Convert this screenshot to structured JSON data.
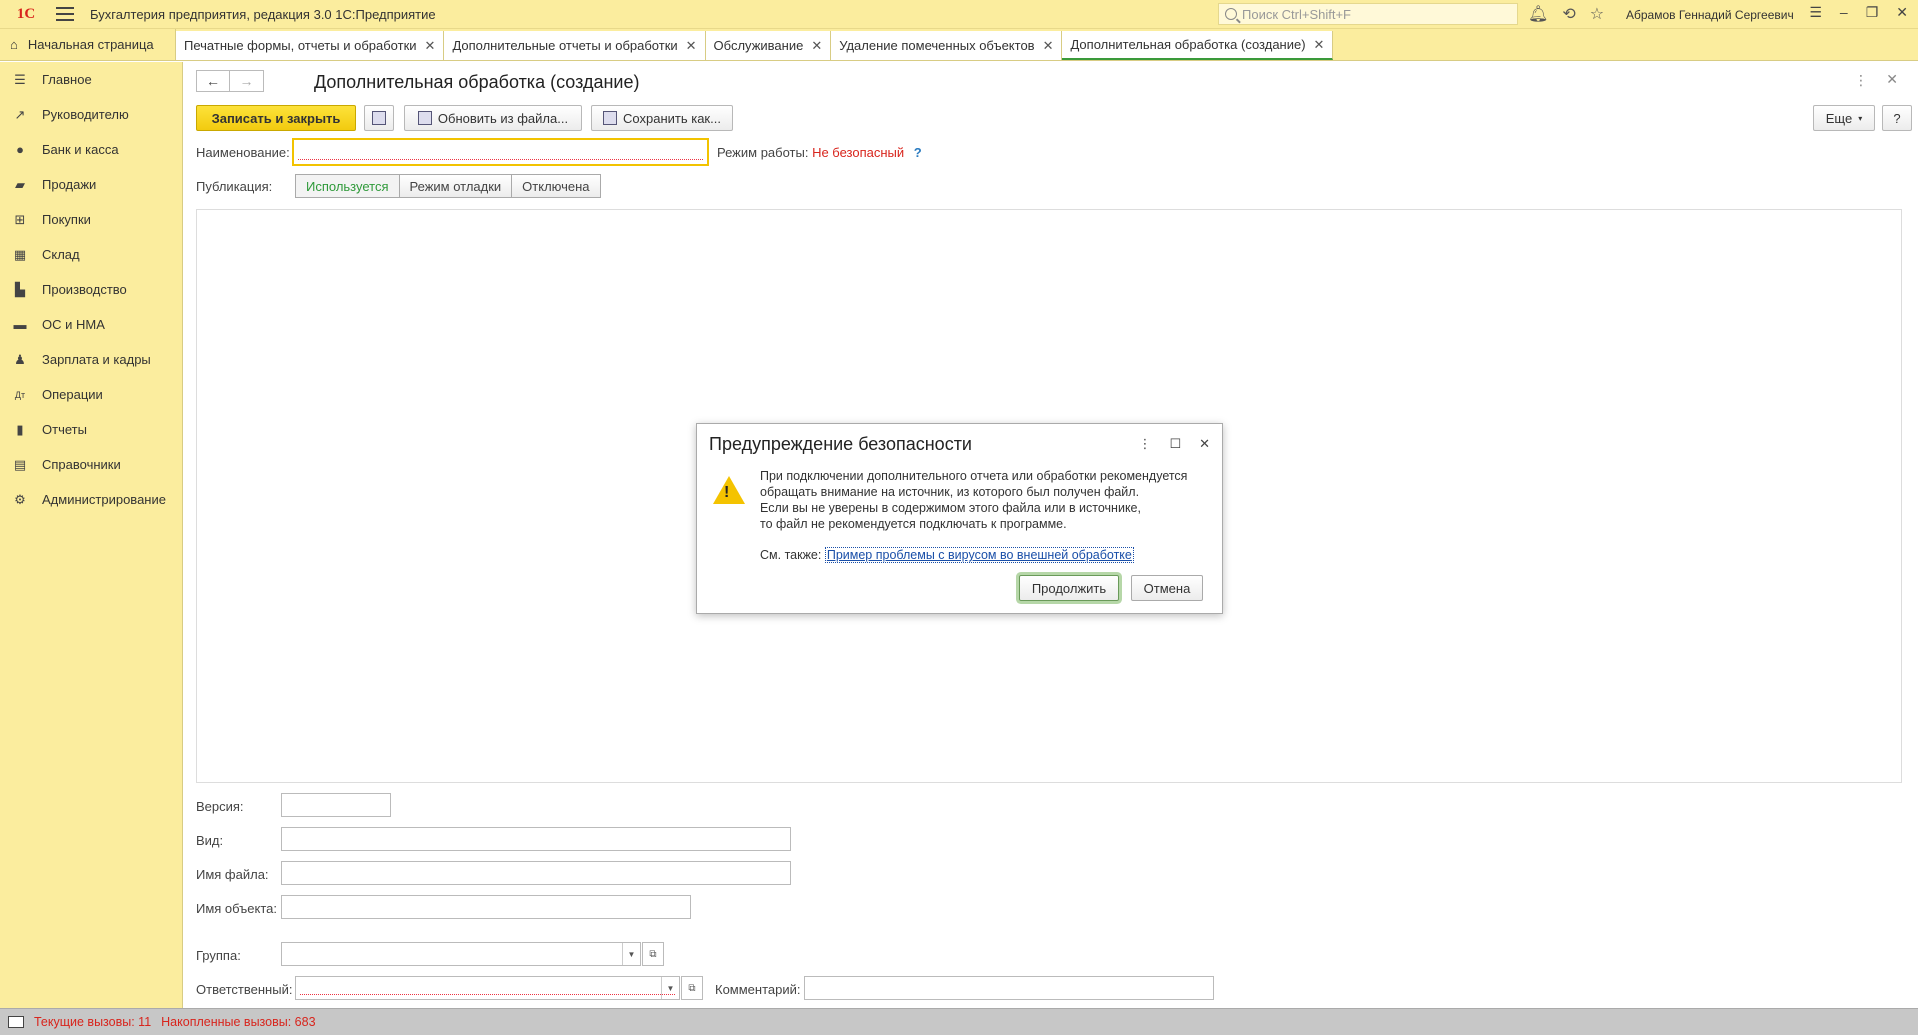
{
  "titlebar": {
    "logo": "1С",
    "app_title": "Бухгалтерия предприятия, редакция 3.0 1С:Предприятие",
    "search_placeholder": "Поиск Ctrl+Shift+F",
    "user_name": "Абрамов Геннадий Сергеевич"
  },
  "tabs": {
    "home": "Начальная страница",
    "items": [
      {
        "label": "Печатные формы, отчеты и обработки"
      },
      {
        "label": "Дополнительные отчеты и обработки"
      },
      {
        "label": "Обслуживание"
      },
      {
        "label": "Удаление помеченных объектов"
      },
      {
        "label": "Дополнительная обработка (создание)"
      }
    ]
  },
  "sidebar": {
    "items": [
      {
        "label": "Главное",
        "icon": "list-icon"
      },
      {
        "label": "Руководителю",
        "icon": "trend-icon"
      },
      {
        "label": "Банк и касса",
        "icon": "coin-icon"
      },
      {
        "label": "Продажи",
        "icon": "bag-icon"
      },
      {
        "label": "Покупки",
        "icon": "cart-icon"
      },
      {
        "label": "Склад",
        "icon": "grid-icon"
      },
      {
        "label": "Производство",
        "icon": "factory-icon"
      },
      {
        "label": "ОС и НМА",
        "icon": "truck-icon"
      },
      {
        "label": "Зарплата и кадры",
        "icon": "person-icon"
      },
      {
        "label": "Операции",
        "icon": "dt-kt-icon"
      },
      {
        "label": "Отчеты",
        "icon": "bar-chart-icon"
      },
      {
        "label": "Справочники",
        "icon": "book-icon"
      },
      {
        "label": "Администрирование",
        "icon": "gear-icon"
      }
    ]
  },
  "form": {
    "title": "Дополнительная обработка (создание)",
    "save_close": "Записать и закрыть",
    "update_from_file": "Обновить из файла...",
    "save_as": "Сохранить как...",
    "more": "Еще",
    "help": "?",
    "name_label": "Наименование:",
    "name_value": "",
    "mode_label": "Режим работы:",
    "mode_value": "Не безопасный",
    "mode_help": "?",
    "publication_label": "Публикация:",
    "publication_options": [
      "Используется",
      "Режим отладки",
      "Отключена"
    ],
    "version_label": "Версия:",
    "kind_label": "Вид:",
    "filename_label": "Имя файла:",
    "objectname_label": "Имя объекта:",
    "group_label": "Группа:",
    "responsible_label": "Ответственный:",
    "comment_label": "Комментарий:"
  },
  "dialog": {
    "title": "Предупреждение безопасности",
    "text_lines": [
      "При подключении дополнительного отчета или обработки рекомендуется",
      "обращать внимание на источник, из которого был получен файл.",
      "Если вы не уверены в содержимом этого файла или в источнике,",
      "то файл не рекомендуется подключать к программе."
    ],
    "see_also": "См. также:",
    "link": "Пример проблемы с вирусом во внешней обработке",
    "continue": "Продолжить",
    "cancel": "Отмена"
  },
  "statusbar": {
    "current_calls": "Текущие вызовы: 11",
    "accumulated_calls": "Накопленные вызовы: 683"
  }
}
